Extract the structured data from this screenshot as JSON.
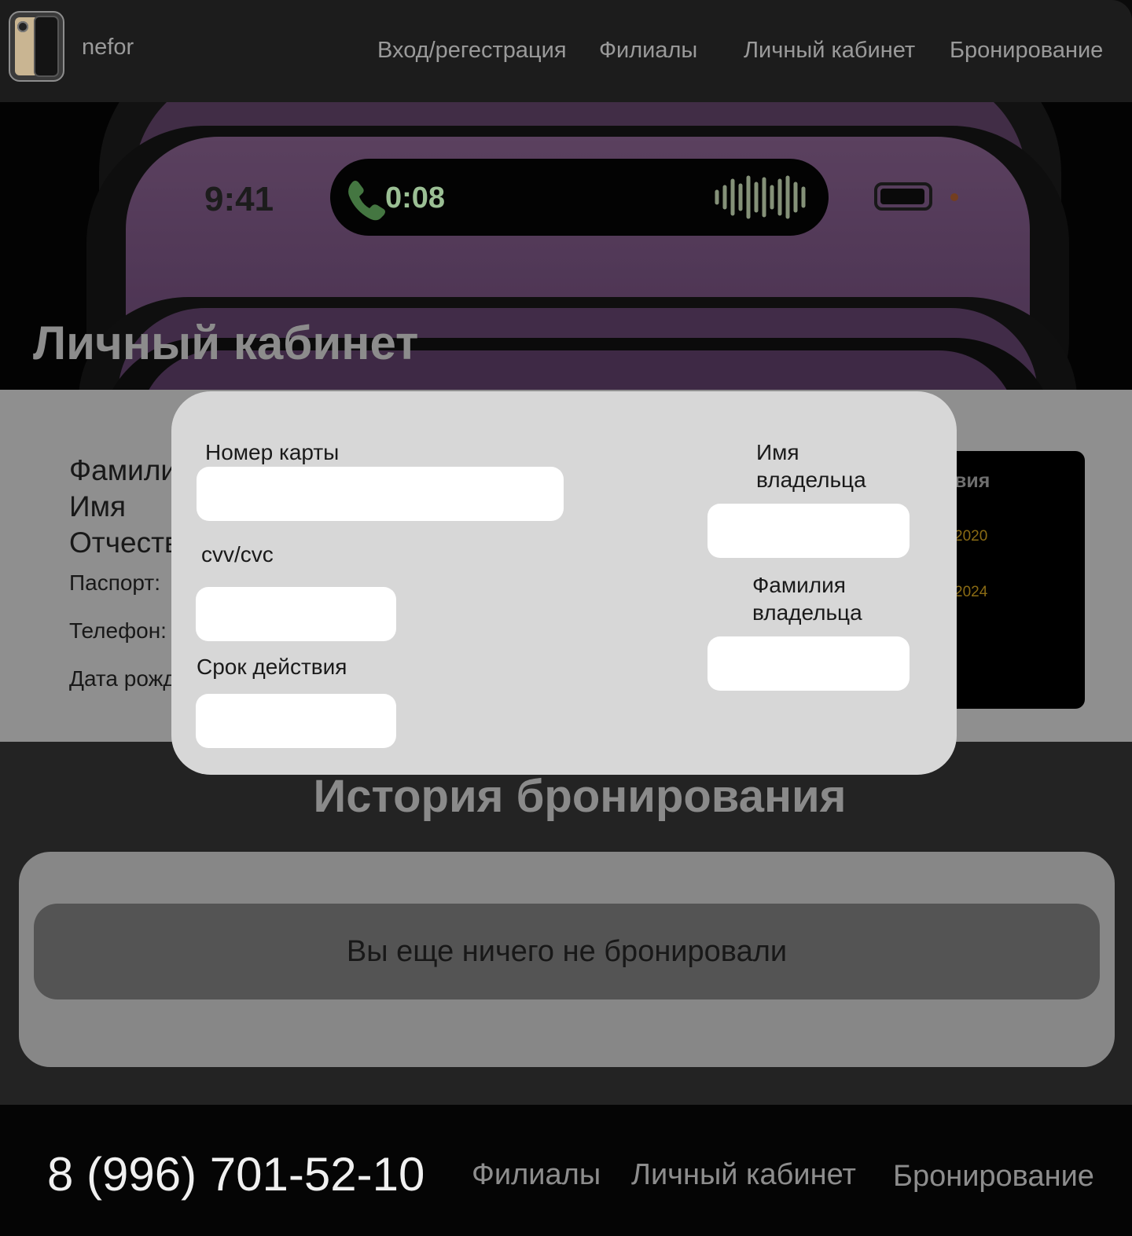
{
  "header": {
    "brand": "nefor",
    "nav": {
      "login": "Вход/регестрация",
      "branches": "Филиалы",
      "cabinet": "Личный кабинет",
      "booking": "Бронирование"
    }
  },
  "hero": {
    "title": "Личный кабинет",
    "phone_time": "9:41",
    "call_time": "0:08"
  },
  "profile": {
    "fields": {
      "surname": "Фамилия",
      "name": "Имя",
      "patronymic": "Отчество",
      "passport": "Паспорт:",
      "phone": "Телефон:",
      "birth_date": "Дата рождения:"
    },
    "card": {
      "title": "вия",
      "date_1": "2020",
      "date_2": "2024"
    }
  },
  "history": {
    "title": "История бронирования",
    "empty_message": "Вы еще ничего не бронировали"
  },
  "footer": {
    "phone": "8 (996) 701-52-10",
    "nav": {
      "branches": "Филиалы",
      "cabinet": "Личный кабинет",
      "booking": "Бронирование"
    }
  },
  "payment_modal": {
    "card_number_label": "Номер карты",
    "card_number_value": "",
    "cvv_label": "cvv/cvc",
    "cvv_value": "",
    "expiry_label": "Срок действия",
    "expiry_value": "",
    "owner_name_label": "Имя владельца",
    "owner_name_value": "",
    "owner_surname_label": "Фамилия владельца",
    "owner_surname_value": ""
  }
}
